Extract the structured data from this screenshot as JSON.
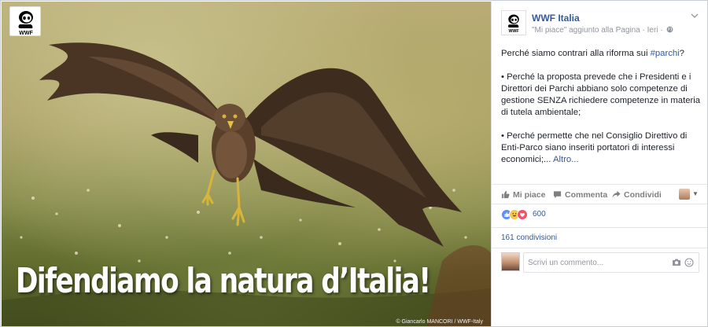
{
  "photo": {
    "headline": "Difendiamo la natura d’Italia!",
    "credit": "© Giancarlo MANCORI / WWF-Italy",
    "logo_text": "WWF"
  },
  "post": {
    "page_name": "WWF Italia",
    "meta": "\"Mi piace\" aggiunto alla Pagina · Ieri ·",
    "body": {
      "intro_prefix": "Perché siamo contrari alla riforma sui ",
      "hashtag": "#parchi",
      "intro_suffix": "?",
      "point1": "• Perché la proposta prevede che i Presidenti e i Direttori dei Parchi abbiano solo competenze di gestione SENZA richiedere competenze in materia di tutela ambientale;",
      "point2_text": "• Perché permette che nel Consiglio Direttivo di Enti-Parco siano inseriti portatori di interessi economici;...",
      "more_link": "Altro..."
    }
  },
  "actions": {
    "like": "Mi piace",
    "comment": "Commenta",
    "share": "Condividi"
  },
  "reactions": {
    "count": "600",
    "types": [
      "like-icon",
      "haha-icon",
      "love-icon"
    ]
  },
  "shares": "161 condivisioni",
  "comment_box": {
    "placeholder": "Scrivi un commento..."
  },
  "colors": {
    "link": "#365899",
    "meta_gray": "#90949c",
    "action_gray": "#7f7f7f"
  }
}
